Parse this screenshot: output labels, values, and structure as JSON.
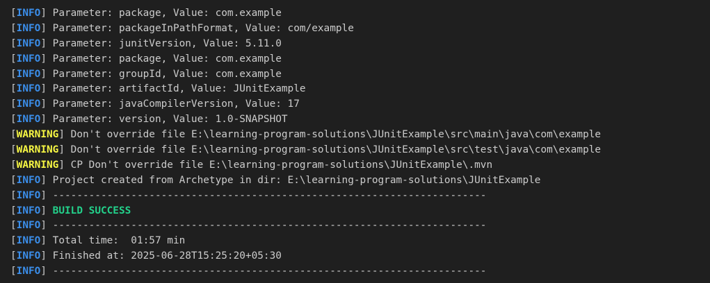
{
  "terminal": {
    "lines": [
      {
        "level": "INFO",
        "text": " Parameter: package, Value: com.example"
      },
      {
        "level": "INFO",
        "text": " Parameter: packageInPathFormat, Value: com/example"
      },
      {
        "level": "INFO",
        "text": " Parameter: junitVersion, Value: 5.11.0"
      },
      {
        "level": "INFO",
        "text": " Parameter: package, Value: com.example"
      },
      {
        "level": "INFO",
        "text": " Parameter: groupId, Value: com.example"
      },
      {
        "level": "INFO",
        "text": " Parameter: artifactId, Value: JUnitExample"
      },
      {
        "level": "INFO",
        "text": " Parameter: javaCompilerVersion, Value: 17"
      },
      {
        "level": "INFO",
        "text": " Parameter: version, Value: 1.0-SNAPSHOT"
      },
      {
        "level": "WARNING",
        "text": " Don't override file E:\\learning-program-solutions\\JUnitExample\\src\\main\\java\\com\\example"
      },
      {
        "level": "WARNING",
        "text": " Don't override file E:\\learning-program-solutions\\JUnitExample\\src\\test\\java\\com\\example"
      },
      {
        "level": "WARNING",
        "text": " CP Don't override file E:\\learning-program-solutions\\JUnitExample\\.mvn"
      },
      {
        "level": "INFO",
        "text": " Project created from Archetype in dir: E:\\learning-program-solutions\\JUnitExample"
      },
      {
        "level": "INFO",
        "text": " ------------------------------------------------------------------------"
      },
      {
        "level": "INFO",
        "text": " ",
        "highlight": "BUILD SUCCESS"
      },
      {
        "level": "INFO",
        "text": " ------------------------------------------------------------------------"
      },
      {
        "level": "INFO",
        "text": " Total time:  01:57 min"
      },
      {
        "level": "INFO",
        "text": " Finished at: 2025-06-28T15:25:20+05:30"
      },
      {
        "level": "INFO",
        "text": " ------------------------------------------------------------------------"
      }
    ]
  },
  "colors": {
    "background": "#1f1f1f",
    "text": "#cccccc",
    "info": "#3b8eea",
    "warning": "#f5f543",
    "success": "#23d18b"
  }
}
